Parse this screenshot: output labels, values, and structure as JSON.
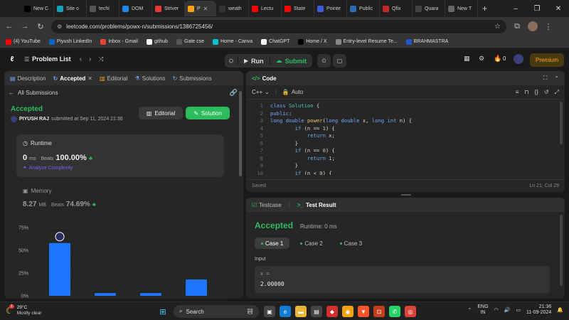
{
  "browser": {
    "tabs": [
      {
        "label": "New C",
        "color": "#000000"
      },
      {
        "label": "Site o",
        "color": "#17a2b8"
      },
      {
        "label": "techi",
        "color": "#555555"
      },
      {
        "label": "DOM",
        "color": "#1e88e5"
      },
      {
        "label": "Striver",
        "color": "#e53935"
      },
      {
        "label": "P",
        "color": "#ffa116",
        "active": true
      },
      {
        "label": "weath",
        "color": "#333333"
      },
      {
        "label": "Lectu",
        "color": "#ff0000"
      },
      {
        "label": "State",
        "color": "#ff0000"
      },
      {
        "label": "Pointe",
        "color": "#3b5bdb"
      },
      {
        "label": "Public",
        "color": "#2b6cb0"
      },
      {
        "label": "Qfix",
        "color": "#c62828"
      },
      {
        "label": "Quara",
        "color": "#444444"
      },
      {
        "label": "New T",
        "color": "#666666"
      }
    ],
    "url": "leetcode.com/problems/powx-n/submissions/1386725456/",
    "bookmarks": [
      {
        "label": "(4) YouTube",
        "color": "#ff0000"
      },
      {
        "label": "Piyush LinkedIn",
        "color": "#0a66c2"
      },
      {
        "label": "Inbox - Gmail",
        "color": "#ea4335"
      },
      {
        "label": "github",
        "color": "#ffffff"
      },
      {
        "label": "Gate cse",
        "color": "#555555"
      },
      {
        "label": "Home - Canva",
        "color": "#00c4cc"
      },
      {
        "label": "ChatGPT",
        "color": "#ffffff"
      },
      {
        "label": "Home / X",
        "color": "#000000"
      },
      {
        "label": "Entry-level Resume Te...",
        "color": "#888888"
      },
      {
        "label": "BRAHMASTRA",
        "color": "#2255cc"
      }
    ]
  },
  "header": {
    "problem_list": "Problem List",
    "run": "Run",
    "submit": "Submit",
    "streak": "0",
    "premium": "Premium"
  },
  "left": {
    "tabs": [
      "Description",
      "Accepted",
      "Editorial",
      "Solutions",
      "Submissions"
    ],
    "all_submissions": "All Submissions",
    "status": "Accepted",
    "user": "PIYUSH RAJ",
    "submitted": "submitted at Sep 11, 2024 21:36",
    "editorial_btn": "Editorial",
    "solution_btn": "Solution",
    "runtime_label": "Runtime",
    "runtime_value": "0",
    "runtime_unit": "ms",
    "beats_label": "Beats",
    "runtime_beats": "100.00%",
    "analyze": "Analyze Complexity",
    "memory_label": "Memory",
    "memory_value": "8.27",
    "memory_unit": "MB",
    "memory_beats": "74.69%"
  },
  "chart_data": {
    "type": "bar",
    "yticks": [
      "75%",
      "50%",
      "25%",
      "0%"
    ],
    "ylim": [
      0,
      75
    ],
    "values": [
      58,
      3,
      3,
      18
    ],
    "colors": {
      "bar": "#1f75fe"
    }
  },
  "code": {
    "title": "Code",
    "language": "C++",
    "mode": "Auto",
    "saved": "Saved",
    "cursor": "Ln 21, Col 29",
    "lines": [
      {
        "n": "1",
        "html": "<span class='kw'>class</span> <span class='ty'>Solution</span> <span class='pl'>{</span>"
      },
      {
        "n": "2",
        "html": "<span class='kw'>public</span><span class='pl'>:</span>"
      },
      {
        "n": "3",
        "html": "<span class='kw'>long double</span> <span class='fn'>power</span><span class='pl'>(</span><span class='kw'>long double</span> <span class='pl'>x, </span><span class='kw'>long int</span> <span class='pl'>n) {</span>"
      },
      {
        "n": "4",
        "html": "        <span class='kw'>if</span> <span class='pl'>(n == </span><span class='num'>1</span><span class='pl'>) {</span>"
      },
      {
        "n": "5",
        "html": "            <span class='kw'>return</span> <span class='pl'>x;</span>"
      },
      {
        "n": "6",
        "html": "        <span class='pl'>}</span>"
      },
      {
        "n": "7",
        "html": "        <span class='kw'>if</span> <span class='pl'>(n == </span><span class='num'>0</span><span class='pl'>) {</span>"
      },
      {
        "n": "8",
        "html": "            <span class='kw'>return</span> <span class='num'>1</span><span class='pl'>;</span>"
      },
      {
        "n": "9",
        "html": "        <span class='pl'>}</span>"
      },
      {
        "n": "10",
        "html": "        <span class='kw'>if</span> <span class='pl'>(n &lt; </span><span class='num'>0</span><span class='pl'>) {</span>"
      }
    ]
  },
  "result": {
    "testcase_tab": "Testcase",
    "result_tab": "Test Result",
    "status": "Accepted",
    "runtime": "Runtime: 0 ms",
    "cases": [
      "Case 1",
      "Case 2",
      "Case 3"
    ],
    "input_label": "Input",
    "var_label": "x =",
    "var_value": "2.00000"
  },
  "taskbar": {
    "temp": "29°C",
    "weather": "Mostly clear",
    "search": "Search",
    "lang1": "ENG",
    "lang2": "IN",
    "time": "21:36",
    "date": "11-09-2024",
    "badge": "1"
  }
}
